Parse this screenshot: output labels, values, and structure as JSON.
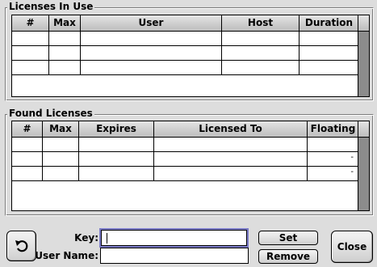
{
  "licenses_in_use": {
    "title": "Licenses In Use",
    "columns": [
      "#",
      "Max",
      "User",
      "Host",
      "Duration"
    ],
    "rows": [
      [
        "",
        "",
        "",
        "",
        ""
      ],
      [
        "",
        "",
        "",
        "",
        ""
      ],
      [
        "",
        "",
        "",
        "",
        ""
      ]
    ]
  },
  "found_licenses": {
    "title": "Found Licenses",
    "columns": [
      "#",
      "Max",
      "Expires",
      "Licensed To",
      "Floating"
    ],
    "rows": [
      [
        "",
        "",
        "",
        "",
        ""
      ],
      [
        "",
        "",
        "",
        "",
        "-"
      ],
      [
        "",
        "",
        "",
        "",
        "-"
      ]
    ]
  },
  "form": {
    "key_label": "Key:",
    "key_value": "",
    "user_name_label": "User Name:",
    "user_name_value": ""
  },
  "buttons": {
    "set": "Set",
    "remove": "Remove",
    "close": "Close"
  },
  "icons": {
    "revert": "revert-arrow-icon"
  }
}
